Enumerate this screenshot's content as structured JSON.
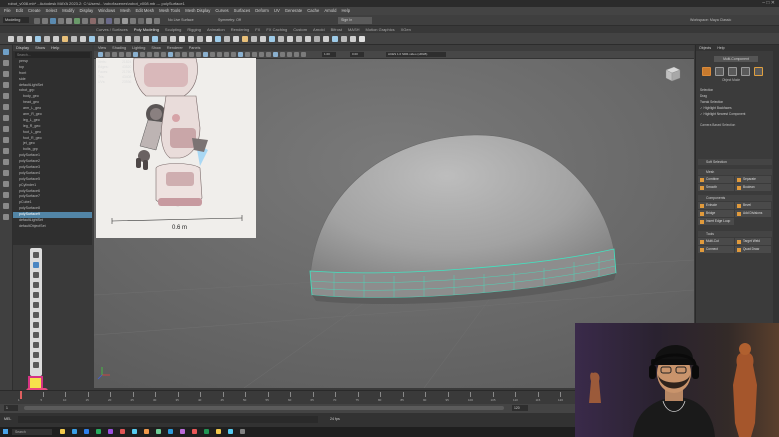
{
  "window": {
    "title": "robot_v008.mb* - Autodesk MAYA 2023.2: C:\\Users\\...\\robot\\scenes\\robot_v008.mb --- polySurface1",
    "controls": "–  □  ✕"
  },
  "menubar": [
    "File",
    "Edit",
    "Create",
    "Select",
    "Modify",
    "Display",
    "Windows",
    "Mesh",
    "Edit Mesh",
    "Mesh Tools",
    "Mesh Display",
    "Curves",
    "Surfaces",
    "Deform",
    "UV",
    "Generate",
    "Cache",
    "Arnold",
    "Help"
  ],
  "statusline": {
    "mode": "Modeling",
    "no_live": "No Live Surface",
    "symmetry": "Symmetry: Off",
    "sign_in": "Sign In",
    "workspace": "Workspace: Maya Classic"
  },
  "shelf_tabs": [
    "Curves / Surfaces",
    "Poly Modeling",
    "Sculpting",
    "Rigging",
    "Animation",
    "Rendering",
    "FX",
    "FX Caching",
    "Custom",
    "Arnold",
    "Bifrost",
    "MASH",
    "Motion Graphics",
    "XGen"
  ],
  "shelf_tab_active": "Poly Modeling",
  "outliner": {
    "menu": [
      "Display",
      "Show",
      "Help"
    ],
    "search_placeholder": "Search...",
    "rows": [
      {
        "label": "persp",
        "sel": false
      },
      {
        "label": "top",
        "sel": false
      },
      {
        "label": "front",
        "sel": false
      },
      {
        "label": "side",
        "sel": false
      },
      {
        "label": "defaultLightSet",
        "sel": false
      },
      {
        "label": "robot_grp",
        "sel": false
      },
      {
        "label": "body_geo",
        "sel": false
      },
      {
        "label": "head_geo",
        "sel": false
      },
      {
        "label": "arm_L_geo",
        "sel": false
      },
      {
        "label": "arm_R_geo",
        "sel": false
      },
      {
        "label": "leg_L_geo",
        "sel": false
      },
      {
        "label": "leg_R_geo",
        "sel": false
      },
      {
        "label": "foot_L_geo",
        "sel": false
      },
      {
        "label": "foot_R_geo",
        "sel": false
      },
      {
        "label": "jet_geo",
        "sel": false
      },
      {
        "label": "bolts_grp",
        "sel": false
      },
      {
        "label": "polySurface1",
        "sel": false
      },
      {
        "label": "polySurface2",
        "sel": false
      },
      {
        "label": "polySurface3",
        "sel": false
      },
      {
        "label": "polySurface4",
        "sel": false
      },
      {
        "label": "polySurface5",
        "sel": false
      },
      {
        "label": "pCylinder1",
        "sel": false
      },
      {
        "label": "polySurface6",
        "sel": false
      },
      {
        "label": "polySurface7",
        "sel": false
      },
      {
        "label": "pCube1",
        "sel": false
      },
      {
        "label": "polySurface8",
        "sel": false
      },
      {
        "label": "polySurface9",
        "sel": true
      },
      {
        "label": "defaultLightSet",
        "sel": false
      },
      {
        "label": "defaultObjectSet",
        "sel": false
      }
    ]
  },
  "viewport": {
    "menu": [
      "View",
      "Shading",
      "Lighting",
      "Show",
      "Renderer",
      "Panels"
    ],
    "camera": "persp",
    "hud": [
      {
        "k": "Verts:",
        "v": "21824"
      },
      {
        "k": "Edges:",
        "v": "43520"
      },
      {
        "k": "Faces:",
        "v": "21760"
      },
      {
        "k": "Tris:",
        "v": "43408"
      },
      {
        "k": "UVs:",
        "v": "23936"
      }
    ],
    "ref_label": "0.6 m",
    "colorspace": "ACES 1.0 SDR-video (sRGB)",
    "gamma": "1.00",
    "exposure": "0.00"
  },
  "modeling_toolkit": {
    "tabs": [
      "Attribute Editor",
      "Modeling Toolkit"
    ],
    "menu": [
      "Objects",
      "Help"
    ],
    "multi_component": "Multi-Component",
    "object_label": "Object Mode",
    "symmetry_label": "Symmetry: Off",
    "options": [
      "Selection",
      "Drag",
      "Tweak Selection",
      "Highlight Backfaces",
      "Highlight Nearest Component"
    ],
    "camera_based": "Camera Based Selection",
    "soft_select": "Soft Selection",
    "sections": {
      "mesh": "Mesh",
      "components": "Components",
      "tools": "Tools"
    },
    "mesh_buttons": [
      "Combine",
      "Separate",
      "Smooth",
      "Boolean"
    ],
    "component_buttons": [
      "Extrude",
      "Bevel",
      "Bridge",
      "Add Divisions",
      "Insert Edge Loop"
    ],
    "tool_buttons": [
      "Multi-Cut",
      "Target Weld",
      "Connect",
      "Quad Draw"
    ]
  },
  "timeline": {
    "ticks": [
      "1",
      "5",
      "10",
      "15",
      "20",
      "25",
      "30",
      "35",
      "40",
      "45",
      "50",
      "55",
      "60",
      "65",
      "70",
      "75",
      "80",
      "85",
      "90",
      "95",
      "100",
      "105",
      "110",
      "115",
      "120"
    ],
    "start": "1",
    "end": "120",
    "current": "1"
  },
  "command_line": {
    "lang": "MEL",
    "fps": "24 fps"
  },
  "taskbar": {
    "search": "Search"
  },
  "colors": {
    "selection": "#5285a6",
    "wireframe": "#41e3c0",
    "webcam_bg": "#1b1a24"
  }
}
